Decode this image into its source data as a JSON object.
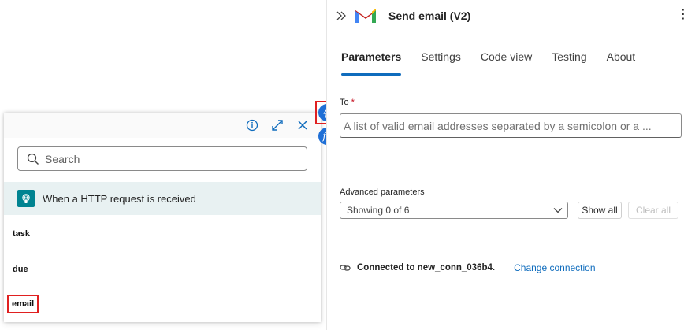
{
  "colors": {
    "accent": "#0f6cbd",
    "highlight_frame": "#e02020",
    "trigger_bg": "#e8f1f2",
    "trigger_icon": "#008391",
    "side_button": "#1f6fd6"
  },
  "popup": {
    "header_icons": [
      "info-icon",
      "expand-icon",
      "close-icon"
    ],
    "search": {
      "placeholder": "Search",
      "value": ""
    },
    "trigger": {
      "label": "When a HTTP request is received",
      "icon": "http-trigger-icon"
    },
    "tokens": [
      {
        "label": "task"
      },
      {
        "label": "due"
      },
      {
        "label": "email"
      }
    ]
  },
  "side_buttons": {
    "dynamic_content_icon": "lightning-icon",
    "expression_icon": "fx-icon",
    "expression_glyph": "fx"
  },
  "panel": {
    "title": "Send email (V2)",
    "connector_icon": "gmail-icon",
    "tabs": [
      {
        "label": "Parameters",
        "active": true
      },
      {
        "label": "Settings",
        "active": false
      },
      {
        "label": "Code view",
        "active": false
      },
      {
        "label": "Testing",
        "active": false
      },
      {
        "label": "About",
        "active": false
      }
    ],
    "to_field": {
      "label": "To",
      "required_mark": "*",
      "placeholder": "A list of valid email addresses separated by a semicolon or a ...",
      "value": ""
    },
    "advanced": {
      "label": "Advanced parameters",
      "selected": "Showing 0 of 6",
      "show_all": "Show all",
      "clear_all": "Clear all"
    },
    "connection": {
      "text": "Connected to new_conn_036b4.",
      "change_link": "Change connection"
    }
  }
}
